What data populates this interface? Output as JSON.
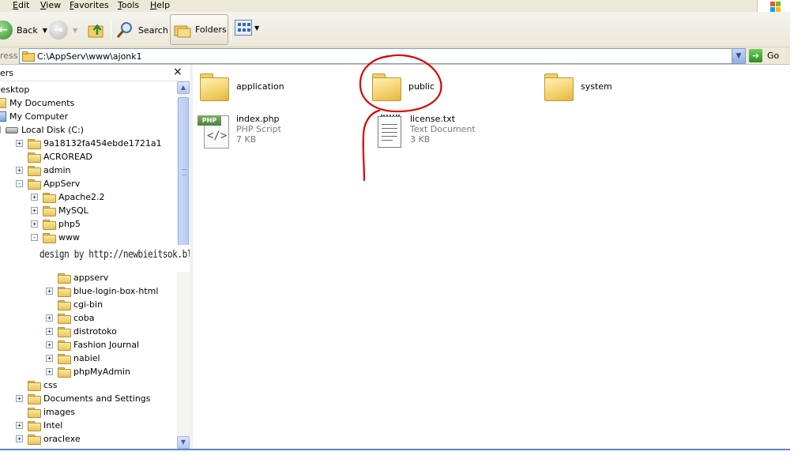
{
  "menubar": {
    "items": [
      {
        "label": "Edit",
        "underline": "E",
        "rest": "dit"
      },
      {
        "label": "View",
        "underline": "V",
        "rest": "iew"
      },
      {
        "label": "Favorites",
        "underline": "F",
        "rest": "avorites"
      },
      {
        "label": "Tools",
        "underline": "T",
        "rest": "ools"
      },
      {
        "label": "Help",
        "underline": "H",
        "rest": "elp"
      }
    ]
  },
  "toolbar": {
    "back_label": "Back",
    "search_label": "Search",
    "folders_label": "Folders"
  },
  "address": {
    "label": "ress",
    "path": "C:\\AppServ\\www\\ajonk1",
    "go_label": "Go"
  },
  "folders_pane": {
    "title": "ers",
    "close_glyph": "×",
    "items": [
      {
        "label": "Desktop",
        "icon": "desktop-icon",
        "expander": "none"
      },
      {
        "label": "My Documents",
        "icon": "my-documents-icon",
        "expander": "none"
      },
      {
        "label": "My Computer",
        "icon": "my-computer-icon",
        "expander": "none"
      },
      {
        "label": "Local Disk (C:)",
        "icon": "disk-icon",
        "expander": "-"
      },
      {
        "label": "9a18132fa454ebde1721a1",
        "icon": "folder-icon",
        "expander": "+"
      },
      {
        "label": "ACROREAD",
        "icon": "folder-icon",
        "expander": "none"
      },
      {
        "label": "admin",
        "icon": "folder-icon",
        "expander": "+"
      },
      {
        "label": "AppServ",
        "icon": "folder-icon",
        "expander": "-"
      },
      {
        "label": "Apache2.2",
        "icon": "folder-icon",
        "expander": "+"
      },
      {
        "label": "MySQL",
        "icon": "folder-icon",
        "expander": "+"
      },
      {
        "label": "php5",
        "icon": "folder-icon",
        "expander": "+"
      },
      {
        "label": "www",
        "icon": "folder-icon",
        "expander": "-"
      },
      {
        "label": "appserv",
        "icon": "folder-icon",
        "expander": "none"
      },
      {
        "label": "blue-login-box-html",
        "icon": "folder-icon",
        "expander": "+"
      },
      {
        "label": "cgi-bin",
        "icon": "folder-icon",
        "expander": "none"
      },
      {
        "label": "coba",
        "icon": "folder-icon",
        "expander": "+"
      },
      {
        "label": "distrotoko",
        "icon": "folder-icon",
        "expander": "+"
      },
      {
        "label": "Fashion Journal",
        "icon": "folder-icon",
        "expander": "+"
      },
      {
        "label": "nabiel",
        "icon": "folder-icon",
        "expander": "+"
      },
      {
        "label": "phpMyAdmin",
        "icon": "folder-icon",
        "expander": "+"
      },
      {
        "label": "css",
        "icon": "folder-icon",
        "expander": "none"
      },
      {
        "label": "Documents and Settings",
        "icon": "folder-icon",
        "expander": "+"
      },
      {
        "label": "images",
        "icon": "folder-icon",
        "expander": "none"
      },
      {
        "label": "Intel",
        "icon": "folder-icon",
        "expander": "+"
      },
      {
        "label": "oraclexe",
        "icon": "folder-icon",
        "expander": "+"
      }
    ]
  },
  "watermark": "design by http://newbieitsok.blogspot.com",
  "content": {
    "folders": [
      {
        "name": "application"
      },
      {
        "name": "public"
      },
      {
        "name": "system"
      }
    ],
    "files": [
      {
        "name": "index.php",
        "type": "PHP Script",
        "size": "7 KB",
        "icon": "php-file-icon",
        "badge": "PHP"
      },
      {
        "name": "license.txt",
        "type": "Text Document",
        "size": "3 KB",
        "icon": "text-file-icon"
      }
    ]
  },
  "colors": {
    "annotation": "#e00000",
    "window_bg": "#ece9d8",
    "selection_border": "#5b86c5"
  }
}
